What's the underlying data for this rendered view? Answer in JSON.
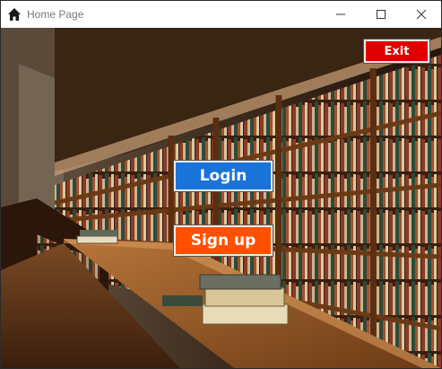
{
  "window": {
    "title": "Home Page",
    "icon": "home-icon",
    "controls": {
      "minimize": "minimize-icon",
      "maximize": "maximize-icon",
      "close": "close-icon"
    }
  },
  "background": {
    "description_icon": "library-background"
  },
  "buttons": {
    "exit": {
      "label": "Exit",
      "color": "#e00000"
    },
    "login": {
      "label": "Login",
      "color": "#1a73d8"
    },
    "signup": {
      "label": "Sign up",
      "color": "#ff5000"
    }
  }
}
